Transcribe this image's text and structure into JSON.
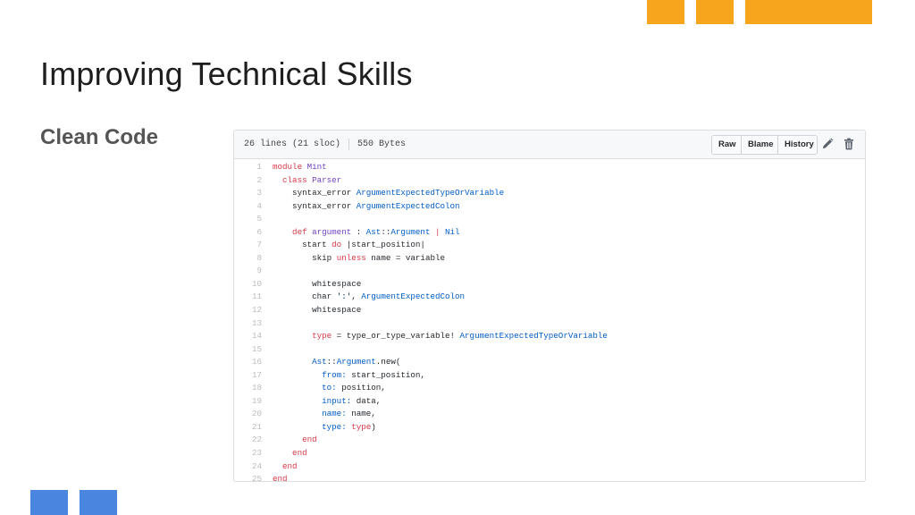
{
  "slide": {
    "title": "Improving Technical Skills",
    "subtitle": "Clean Code",
    "colors": {
      "orange": "#f7a51c",
      "blue": "#4a86e0"
    }
  },
  "file_header": {
    "lines_info": "26 lines (21 sloc)",
    "size": "550 Bytes",
    "buttons": {
      "raw": "Raw",
      "blame": "Blame",
      "history": "History"
    },
    "icons": [
      "pencil-icon",
      "trash-icon"
    ]
  },
  "code_lines": [
    [
      {
        "t": "module ",
        "c": "kw"
      },
      {
        "t": "Mint",
        "c": "cls"
      }
    ],
    [
      {
        "t": "  class ",
        "c": "kw"
      },
      {
        "t": "Parser",
        "c": "cls"
      }
    ],
    [
      {
        "t": "    syntax_error ",
        "c": "code"
      },
      {
        "t": "ArgumentExpectedTypeOrVariable",
        "c": "cn"
      }
    ],
    [
      {
        "t": "    syntax_error ",
        "c": "code"
      },
      {
        "t": "ArgumentExpectedColon",
        "c": "cn"
      }
    ],
    [],
    [
      {
        "t": "    def ",
        "c": "kw"
      },
      {
        "t": "argument",
        "c": "cls"
      },
      {
        "t": " : ",
        "c": "code"
      },
      {
        "t": "Ast",
        "c": "cn"
      },
      {
        "t": "::",
        "c": "code"
      },
      {
        "t": "Argument",
        "c": "cn"
      },
      {
        "t": " | ",
        "c": "kw"
      },
      {
        "t": "Nil",
        "c": "cn"
      }
    ],
    [
      {
        "t": "      start ",
        "c": "code"
      },
      {
        "t": "do",
        "c": "kw"
      },
      {
        "t": " |start_position|",
        "c": "code"
      }
    ],
    [
      {
        "t": "        skip ",
        "c": "code"
      },
      {
        "t": "unless",
        "c": "kw"
      },
      {
        "t": " name = variable",
        "c": "code"
      }
    ],
    [],
    [
      {
        "t": "        whitespace",
        "c": "code"
      }
    ],
    [
      {
        "t": "        char ",
        "c": "code"
      },
      {
        "t": "':'",
        "c": "str"
      },
      {
        "t": ", ",
        "c": "code"
      },
      {
        "t": "ArgumentExpectedColon",
        "c": "cn"
      }
    ],
    [
      {
        "t": "        whitespace",
        "c": "code"
      }
    ],
    [],
    [
      {
        "t": "        type",
        "c": "kw"
      },
      {
        "t": " = type_or_type_variable! ",
        "c": "code"
      },
      {
        "t": "ArgumentExpectedTypeOrVariable",
        "c": "cn"
      }
    ],
    [],
    [
      {
        "t": "        Ast",
        "c": "cn"
      },
      {
        "t": "::",
        "c": "code"
      },
      {
        "t": "Argument",
        "c": "cn"
      },
      {
        "t": ".new(",
        "c": "code"
      }
    ],
    [
      {
        "t": "          from:",
        "c": "cn"
      },
      {
        "t": " start_position,",
        "c": "code"
      }
    ],
    [
      {
        "t": "          to:",
        "c": "cn"
      },
      {
        "t": " position,",
        "c": "code"
      }
    ],
    [
      {
        "t": "          input:",
        "c": "cn"
      },
      {
        "t": " data,",
        "c": "code"
      }
    ],
    [
      {
        "t": "          name:",
        "c": "cn"
      },
      {
        "t": " name,",
        "c": "code"
      }
    ],
    [
      {
        "t": "          type:",
        "c": "cn"
      },
      {
        "t": " ",
        "c": "code"
      },
      {
        "t": "type",
        "c": "kw"
      },
      {
        "t": ")",
        "c": "code"
      }
    ],
    [
      {
        "t": "      end",
        "c": "kw"
      }
    ],
    [
      {
        "t": "    end",
        "c": "kw"
      }
    ],
    [
      {
        "t": "  end",
        "c": "kw"
      }
    ],
    [
      {
        "t": "end",
        "c": "kw"
      }
    ]
  ]
}
